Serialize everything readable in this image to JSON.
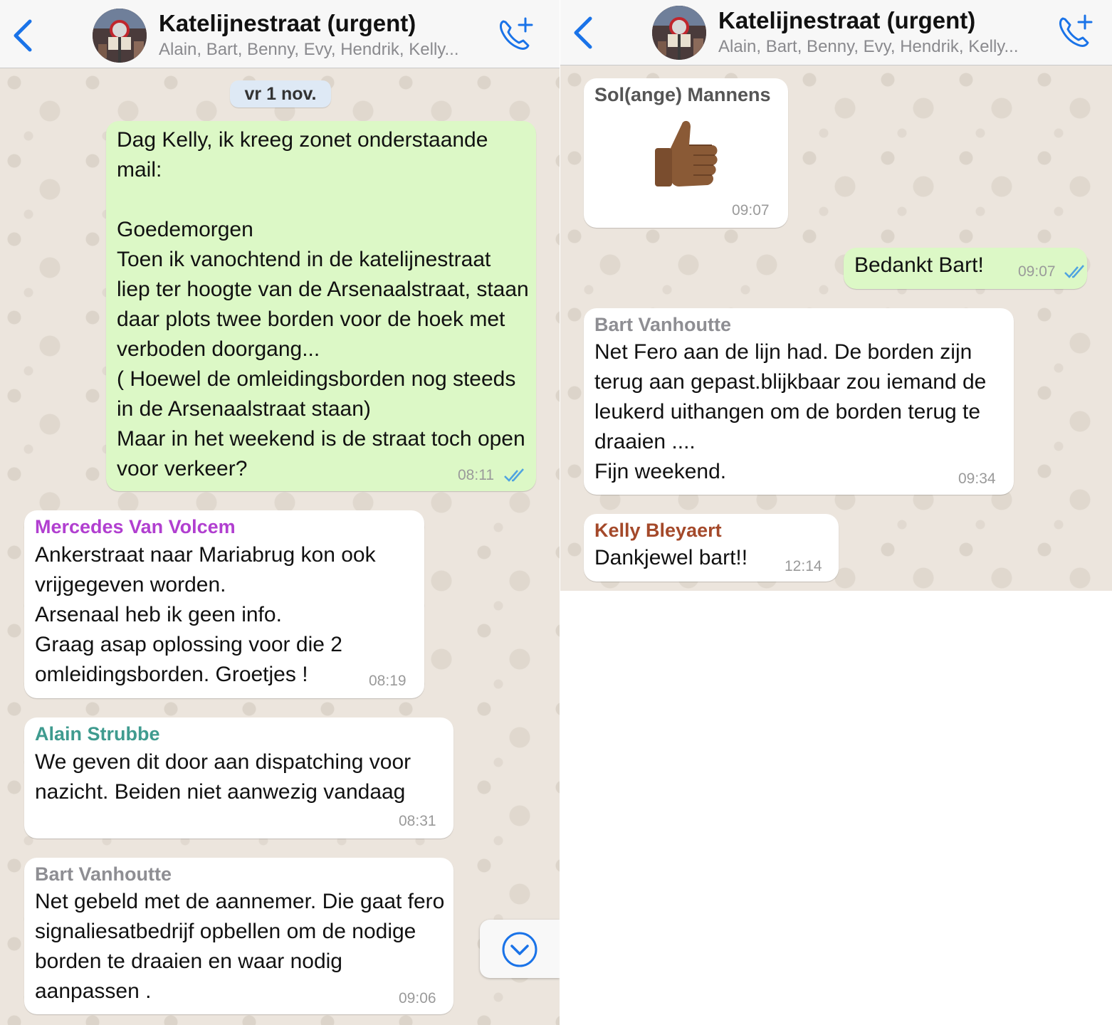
{
  "chat": {
    "title": "Katelijnestraat (urgent)",
    "members": "Alain, Bart, Benny, Evy, Hendrik, Kelly..."
  },
  "date_divider": "vr 1 nov.",
  "left_messages": [
    {
      "sender": "",
      "text": "Dag Kelly, ik kreeg zonet onderstaande mail:\n\nGoedemorgen\nToen ik vanochtend in de katelijnestraat liep ter hoogte van de Arsenaalstraat, staan daar plots twee borden voor de hoek met verboden doorgang...\n( Hoewel de omleidingsborden nog steeds in de Arsenaalstraat staan)\nMaar in het weekend is de straat toch open voor verkeer?",
      "time": "08:11"
    },
    {
      "sender": "Mercedes Van Volcem",
      "text": "Ankerstraat naar Mariabrug kon ook vrijgegeven worden.\nArsenaal heb ik geen info.\nGraag asap oplossing voor die 2 omleidingsborden. Groetjes !",
      "time": "08:19"
    },
    {
      "sender": "Alain Strubbe",
      "text": "We geven dit door aan dispatching voor nazicht. Beiden niet aanwezig vandaag",
      "time": "08:31"
    },
    {
      "sender": "Bart Vanhoutte",
      "text": "Net gebeld met de aannemer. Die gaat fero signaliesatbedrijf  opbellen om de nodige borden te draaien en waar nodig aanpassen .",
      "time": "09:06"
    }
  ],
  "right_messages": [
    {
      "sender": "Sol(ange) Mannens",
      "sticker": "thumbs-up",
      "time": "09:07"
    },
    {
      "sender": "",
      "text": "Bedankt Bart!",
      "time": "09:07"
    },
    {
      "sender": "Bart Vanhoutte",
      "text": "Net Fero aan de lijn had. De borden zijn terug aan gepast.blijkbaar zou iemand de leukerd uithangen  om de borden terug te draaien ....\nFijn weekend.",
      "time": "09:34"
    },
    {
      "sender": "Kelly Bleyaert",
      "text": "Dankjewel bart!!",
      "time": "12:14"
    }
  ],
  "colors": {
    "accent": "#1a73e8",
    "incoming_bubble": "#ffffff",
    "outgoing_bubble": "#dcf8c6",
    "sender_mercedes": "#b13fd0",
    "sender_alain": "#3f9b8f",
    "sender_bart": "#8e8e93",
    "sender_solange": "#555555",
    "sender_kelly": "#a4492a",
    "read_ticks": "#4fa3e0"
  },
  "icons": [
    "back-chevron-icon",
    "group-avatar",
    "add-call-icon",
    "double-check-icon",
    "scroll-down-icon"
  ]
}
